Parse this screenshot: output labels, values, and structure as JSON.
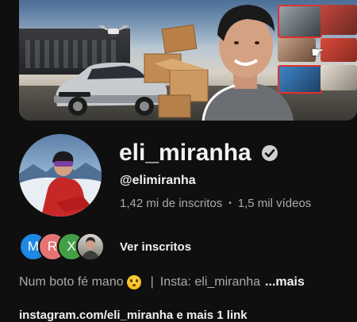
{
  "channel": {
    "name": "eli_miranha",
    "handle": "@elimiranha",
    "subscribers": "1,42 mi de inscritos",
    "separator": "•",
    "videos": "1,5 mil vídeos",
    "verified_icon": "verified-check-icon"
  },
  "subscribers_row": {
    "avatars": [
      "M",
      "R",
      "X"
    ],
    "avatar_colors": [
      "#1e88e5",
      "#e57373",
      "#43a047"
    ],
    "label": "Ver inscritos"
  },
  "description": {
    "text_before_emoji": "Num boto fé mano",
    "emoji": "flushed-face",
    "divider": "|",
    "text_after": "Insta: eli_miranha",
    "more_label": "...mais"
  },
  "links": {
    "text": "instagram.com/eli_miranha e mais 1 link"
  },
  "colors": {
    "background": "#0f0f0f",
    "primary_text": "#f1f1f1",
    "secondary_text": "#aaaaaa"
  }
}
